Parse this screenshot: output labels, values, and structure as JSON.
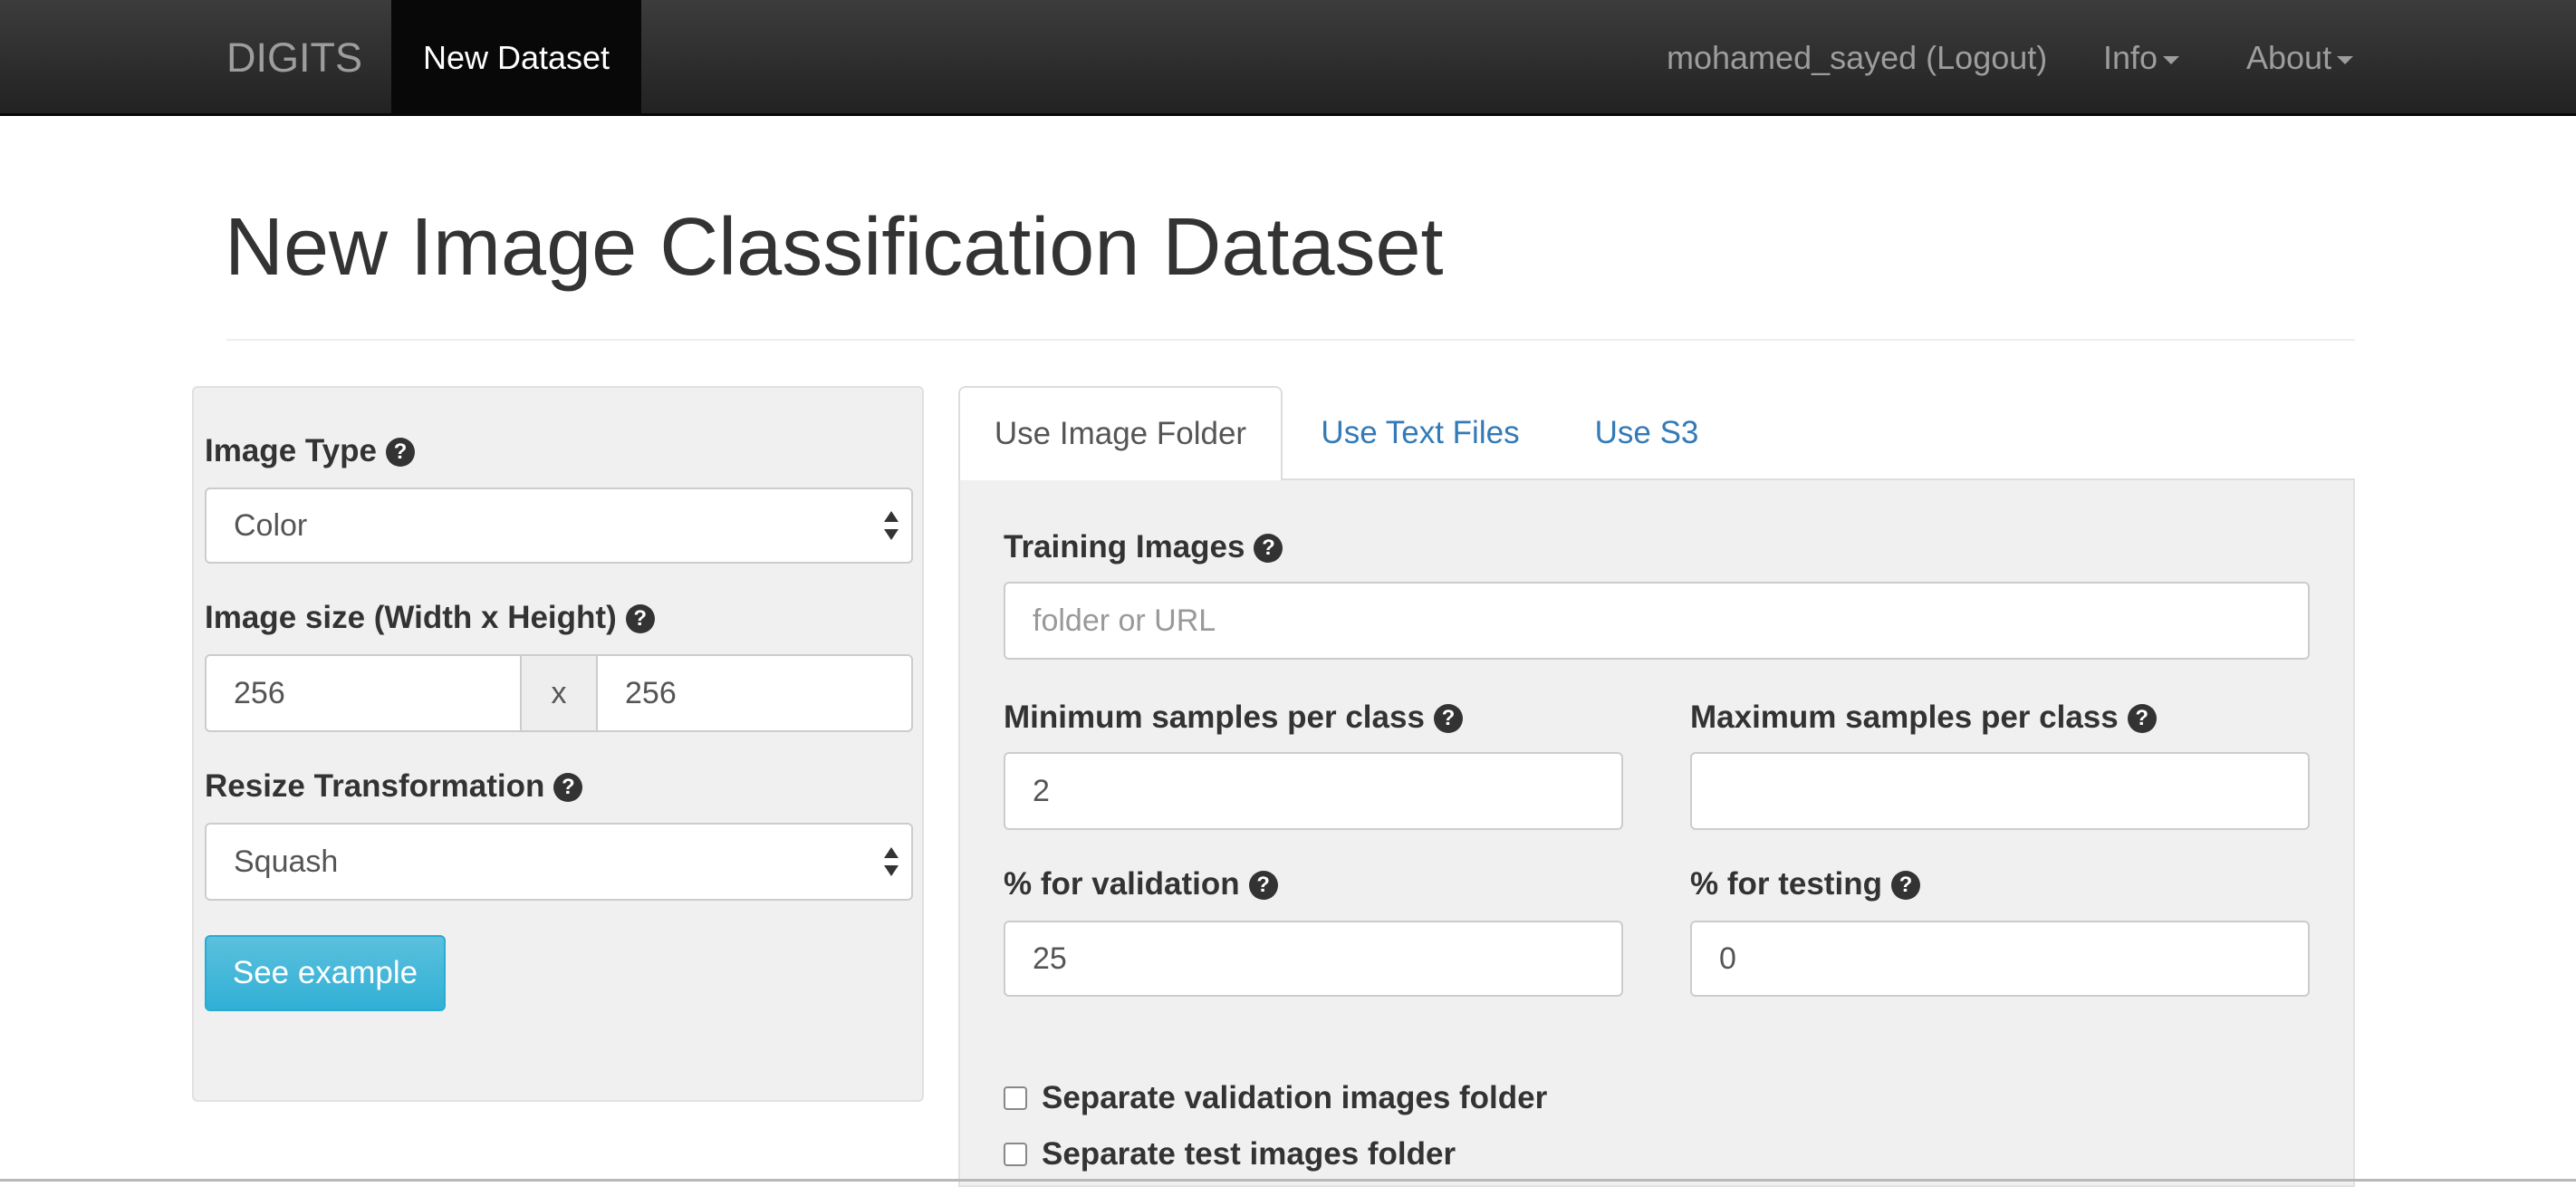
{
  "navbar": {
    "brand": "DIGITS",
    "active_item": "New Dataset",
    "user": "mohamed_sayed (Logout)",
    "info": "Info",
    "about": "About"
  },
  "page": {
    "title": "New Image Classification Dataset"
  },
  "left_panel": {
    "image_type": {
      "label": "Image Type",
      "value": "Color"
    },
    "image_size": {
      "label": "Image size (Width x Height)",
      "width": "256",
      "separator": "x",
      "height": "256"
    },
    "resize": {
      "label": "Resize Transformation",
      "value": "Squash"
    },
    "see_example_button": "See example"
  },
  "tabs": [
    {
      "label": "Use Image Folder",
      "active": true
    },
    {
      "label": "Use Text Files",
      "active": false
    },
    {
      "label": "Use S3",
      "active": false
    }
  ],
  "folder_form": {
    "training_images": {
      "label": "Training Images",
      "placeholder": "folder or URL",
      "value": ""
    },
    "min_samples": {
      "label": "Minimum samples per class",
      "value": "2"
    },
    "max_samples": {
      "label": "Maximum samples per class",
      "value": ""
    },
    "pct_validation": {
      "label": "% for validation",
      "value": "25"
    },
    "pct_testing": {
      "label": "% for testing",
      "value": "0"
    },
    "separate_validation": {
      "label": "Separate validation images folder",
      "checked": false
    },
    "separate_test": {
      "label": "Separate test images folder",
      "checked": false
    }
  },
  "icons": {
    "help": "question-circle-icon",
    "caret": "caret-down-icon",
    "select": "select-arrows-icon"
  },
  "colors": {
    "navbar": "#222222",
    "link": "#337ab7",
    "button_info": "#5bc0de",
    "panel_bg": "#f0f0f0"
  }
}
